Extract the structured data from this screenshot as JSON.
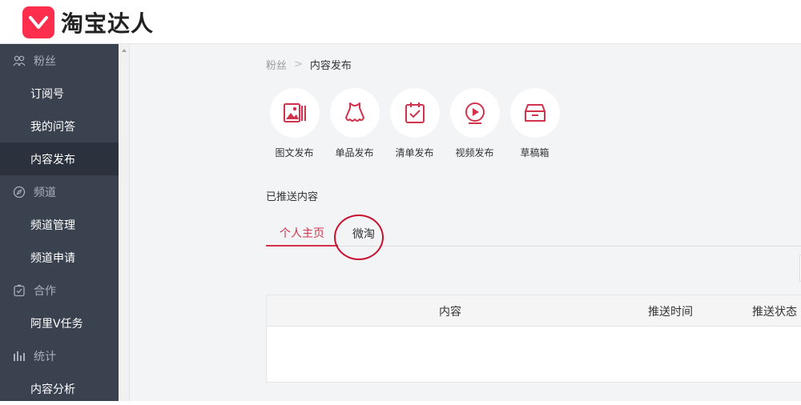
{
  "header": {
    "logo_text": "淘宝达人",
    "brand_color": "#ff2e4d"
  },
  "sidebar": {
    "groups": [
      {
        "label": "粉丝",
        "icon": "fans-icon",
        "items": [
          {
            "label": "订阅号",
            "active": false
          },
          {
            "label": "我的问答",
            "active": false
          },
          {
            "label": "内容发布",
            "active": true
          }
        ]
      },
      {
        "label": "频道",
        "icon": "compass-icon",
        "items": [
          {
            "label": "频道管理",
            "active": false
          },
          {
            "label": "频道申请",
            "active": false
          }
        ]
      },
      {
        "label": "合作",
        "icon": "clipboard-check-icon",
        "items": [
          {
            "label": "阿里V任务",
            "active": false
          }
        ]
      },
      {
        "label": "统计",
        "icon": "bar-chart-icon",
        "items": [
          {
            "label": "内容分析",
            "active": false
          }
        ]
      }
    ]
  },
  "breadcrumb": {
    "parent": "粉丝",
    "separator": ">",
    "current": "内容发布"
  },
  "publish": {
    "items": [
      {
        "label": "图文发布",
        "icon": "image-text-icon"
      },
      {
        "label": "单品发布",
        "icon": "dress-icon"
      },
      {
        "label": "清单发布",
        "icon": "checklist-icon"
      },
      {
        "label": "视频发布",
        "icon": "video-play-icon"
      },
      {
        "label": "草稿箱",
        "icon": "drafts-box-icon"
      }
    ],
    "accent": "#d2334c"
  },
  "pushed": {
    "title": "已推送内容",
    "tabs": [
      {
        "label": "个人主页",
        "active": true
      },
      {
        "label": "微淘",
        "active": false
      }
    ],
    "columns": [
      "内容",
      "推送时间",
      "推送状态"
    ],
    "annotation_color": "#c8102e"
  }
}
